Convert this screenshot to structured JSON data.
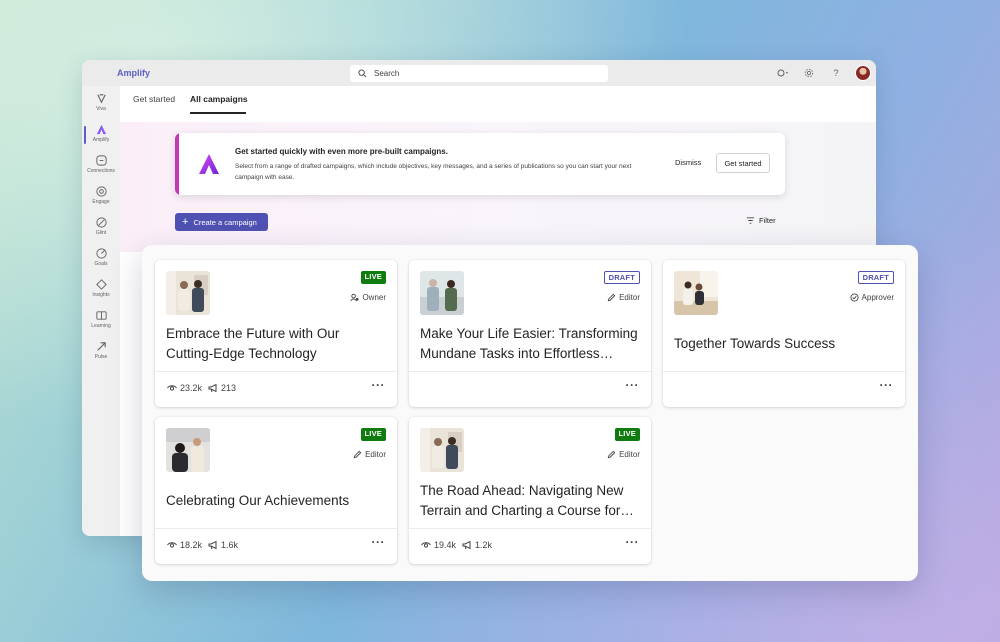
{
  "app": {
    "name": "Amplify",
    "search_placeholder": "Search"
  },
  "rail": [
    {
      "label": "Viva",
      "icon": "viva-icon"
    },
    {
      "label": "Amplify",
      "icon": "amplify-icon",
      "active": true
    },
    {
      "label": "Connections",
      "icon": "connections-icon"
    },
    {
      "label": "Engage",
      "icon": "engage-icon"
    },
    {
      "label": "Glint",
      "icon": "glint-icon"
    },
    {
      "label": "Goals",
      "icon": "goals-icon"
    },
    {
      "label": "Insights",
      "icon": "insights-icon"
    },
    {
      "label": "Learning",
      "icon": "learning-icon"
    },
    {
      "label": "Pulse",
      "icon": "pulse-icon"
    }
  ],
  "tabs": [
    {
      "label": "Get started",
      "active": false
    },
    {
      "label": "All campaigns",
      "active": true
    }
  ],
  "banner": {
    "title": "Get started quickly with even more pre-built campaigns.",
    "text": "Select from a range of drafted campaigns, which include objectives, key messages, and a series of publications so you can start your next campaign with ease.",
    "dismiss_label": "Dismiss",
    "get_started_label": "Get started"
  },
  "toolbar": {
    "create_label": "Create a campaign",
    "filter_label": "Filter"
  },
  "colors": {
    "accent": "#4f52b2",
    "live": "#107c10",
    "banner_stripe": "#c239b3"
  },
  "cards": [
    {
      "status": "LIVE",
      "role": "Owner",
      "title": "Embrace the Future with Our Cutting-Edge Technology",
      "views": "23.2k",
      "announcements": "213"
    },
    {
      "status": "DRAFT",
      "role": "Editor",
      "title": "Make Your Life Easier: Transforming Mundane Tasks into Effortless…",
      "views": "",
      "announcements": ""
    },
    {
      "status": "DRAFT",
      "role": "Approver",
      "title": "Together Towards Success",
      "views": "",
      "announcements": ""
    },
    {
      "status": "LIVE",
      "role": "Editor",
      "title": "Celebrating Our Achievements",
      "views": "18.2k",
      "announcements": "1.6k"
    },
    {
      "status": "LIVE",
      "role": "Editor",
      "title": "The Road Ahead: Navigating New Terrain and Charting a Course for…",
      "views": "19.4k",
      "announcements": "1.2k"
    }
  ]
}
